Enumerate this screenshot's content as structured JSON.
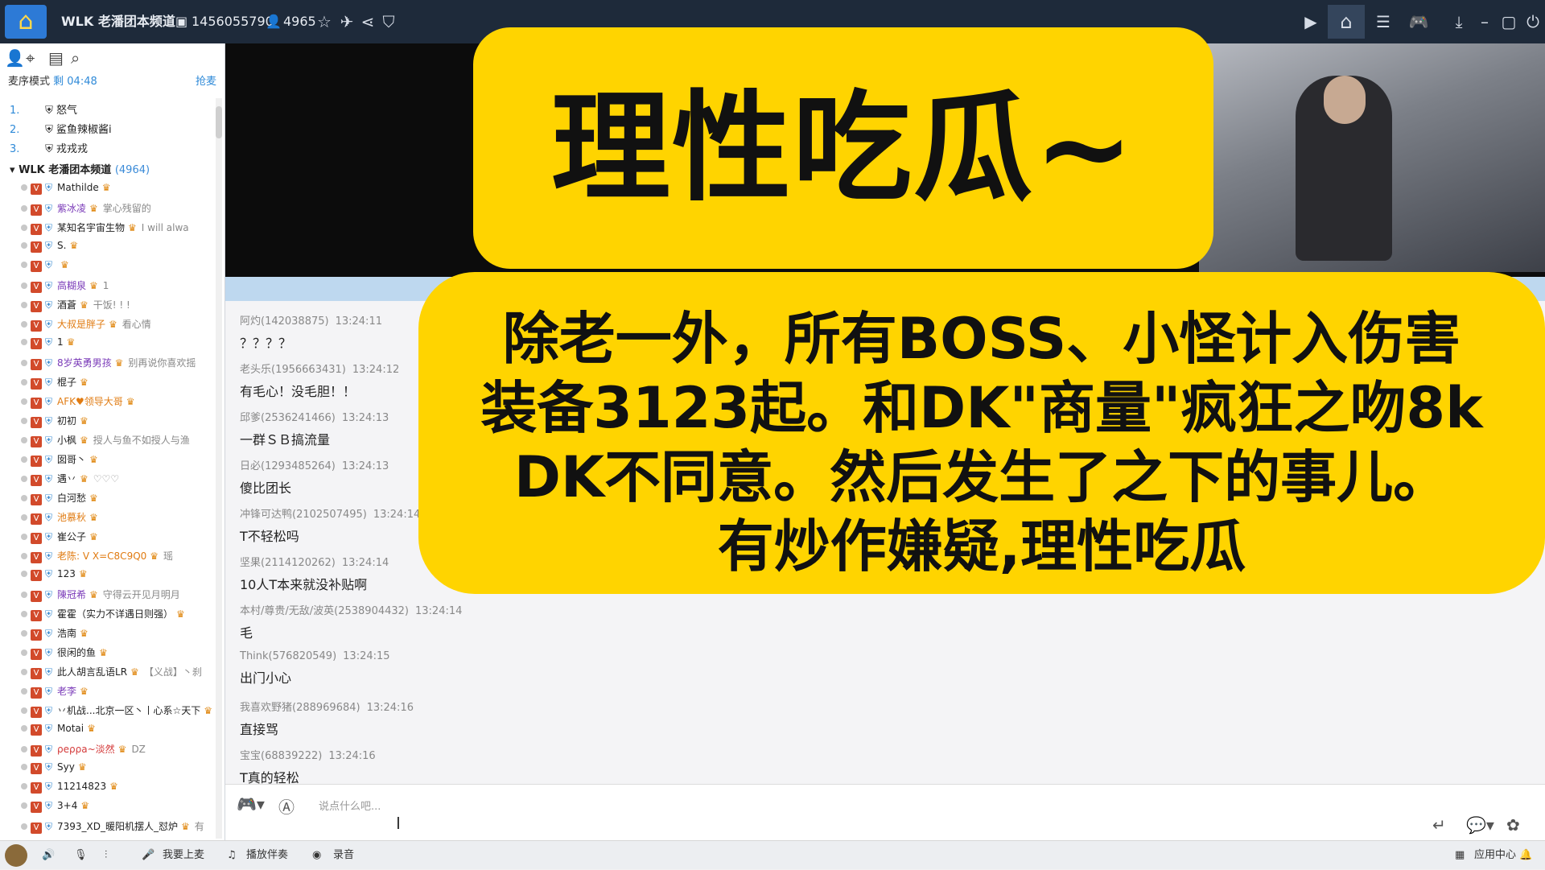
{
  "titlebar": {
    "title": "WLK 老潘团本频道",
    "channel_id": "1456055790",
    "online": "4965",
    "icons": [
      "house-logo",
      "id-icon",
      "user-icon",
      "star-icon",
      "plane-icon",
      "share-icon",
      "shield-icon",
      "record-icon",
      "home-icon",
      "list-icon",
      "gamepad-icon",
      "minimize-icon",
      "restore-icon",
      "close-icon",
      "power-icon"
    ]
  },
  "sidebar": {
    "mode_label": "麦序模式",
    "mode_time": "剩 04:48",
    "grab_label": "抢麦",
    "queue": [
      {
        "n": "1.",
        "name": "怒气"
      },
      {
        "n": "2.",
        "name": "鲨鱼辣椒酱i"
      },
      {
        "n": "3.",
        "name": "戎戎戎"
      }
    ],
    "channel_name": "WLK 老潘团本频道",
    "channel_count": "(4964)",
    "members": [
      {
        "name": "Mathilde",
        "style": "",
        "tag": ""
      },
      {
        "name": "紫冰凌",
        "style": "purple",
        "tag": "掌心残留的"
      },
      {
        "name": "某知名宇宙生物",
        "style": "",
        "tag": "I will alwa"
      },
      {
        "name": "S.",
        "style": "",
        "tag": ""
      },
      {
        "name": "",
        "style": "",
        "tag": ""
      },
      {
        "name": "高糊泉",
        "style": "purple",
        "tag": "1"
      },
      {
        "name": "酒蒼",
        "style": "",
        "tag": "干饭! ! !"
      },
      {
        "name": "大叔是胖子",
        "style": "orange",
        "tag": "看心情"
      },
      {
        "name": "1",
        "style": "",
        "tag": ""
      },
      {
        "name": "8岁英勇男孩",
        "style": "purple",
        "tag": "别再说你喜欢摇"
      },
      {
        "name": "棍子",
        "style": "",
        "tag": ""
      },
      {
        "name": "AFK♥领导大哥",
        "style": "orange",
        "tag": ""
      },
      {
        "name": "初初",
        "style": "",
        "tag": ""
      },
      {
        "name": "小枫",
        "style": "",
        "tag": "授人与鱼不如授人与渔"
      },
      {
        "name": "囡哥丶",
        "style": "",
        "tag": ""
      },
      {
        "name": "遇丷",
        "style": "",
        "tag": "♡♡♡"
      },
      {
        "name": "白河愁",
        "style": "",
        "tag": ""
      },
      {
        "name": "池慕秋",
        "style": "orange",
        "tag": ""
      },
      {
        "name": "崔公子",
        "style": "",
        "tag": ""
      },
      {
        "name": "老陈: V X=C8C9Q0",
        "style": "orange",
        "tag": "瑶"
      },
      {
        "name": "123",
        "style": "",
        "tag": ""
      },
      {
        "name": "陳冠希",
        "style": "purple",
        "tag": "守得云开见月明月"
      },
      {
        "name": "霍霍（实力不详遇日则强）",
        "style": "",
        "tag": ""
      },
      {
        "name": "浩南",
        "style": "",
        "tag": ""
      },
      {
        "name": "很闲的鱼",
        "style": "",
        "tag": ""
      },
      {
        "name": "此人胡言乱语LR",
        "style": "",
        "tag": "【义战】丶刹"
      },
      {
        "name": "老李",
        "style": "purple",
        "tag": ""
      },
      {
        "name": "丷机战...北京一区丶丨心系☆天下",
        "style": "",
        "tag": ""
      },
      {
        "name": "Motai",
        "style": "",
        "tag": ""
      },
      {
        "name": "ρeρρa~淡然",
        "style": "red",
        "tag": "DZ"
      },
      {
        "name": "Syy",
        "style": "",
        "tag": ""
      },
      {
        "name": "11214823",
        "style": "",
        "tag": ""
      },
      {
        "name": "3+4",
        "style": "",
        "tag": ""
      },
      {
        "name": "7393_XD_暖阳机摆人_怼炉",
        "style": "",
        "tag": "有"
      }
    ]
  },
  "overlay": {
    "title": "理性吃瓜~",
    "note_lines": [
      "除老一外，所有BOSS、小怪计入伤害",
      "装备3123起。和DK\"商量\"疯狂之吻8k",
      "DK不同意。然后发生了之下的事儿。",
      "有炒作嫌疑,理性吃瓜"
    ]
  },
  "chat": {
    "messages": [
      {
        "user": "阿灼(142038875)",
        "time": "13:24:11",
        "text": "？？？？"
      },
      {
        "user": "老头乐(1956663431)",
        "time": "13:24:12",
        "text": "有毛心！没毛胆！！"
      },
      {
        "user": "邱爹(2536241466)",
        "time": "13:24:13",
        "text": "一群ＳＢ搞流量"
      },
      {
        "user": "日必(1293485264)",
        "time": "13:24:13",
        "text": "傻比团长"
      },
      {
        "user": "冲锋可达鸭(2102507495)",
        "time": "13:24:14",
        "text": "T不轻松吗"
      },
      {
        "user": "坚果(2114120262)",
        "time": "13:24:14",
        "text": "10人T本来就没补贴啊"
      },
      {
        "user": "本村/尊贵/无敌/波英(2538904432)",
        "time": "13:24:14",
        "text": "毛"
      },
      {
        "user": "Think(576820549)",
        "time": "13:24:15",
        "text": "出门小心"
      },
      {
        "user": "我喜欢野猪(288969684)",
        "time": "13:24:16",
        "text": "直接骂"
      },
      {
        "user": "宝宝(68839222)",
        "time": "13:24:16",
        "text": "T真的轻松"
      }
    ]
  },
  "input": {
    "placeholder": "说点什么吧..."
  },
  "bottombar": {
    "mic_up": "我要上麦",
    "play_music": "播放伴奏",
    "record": "录音",
    "app_center": "应用中心"
  }
}
